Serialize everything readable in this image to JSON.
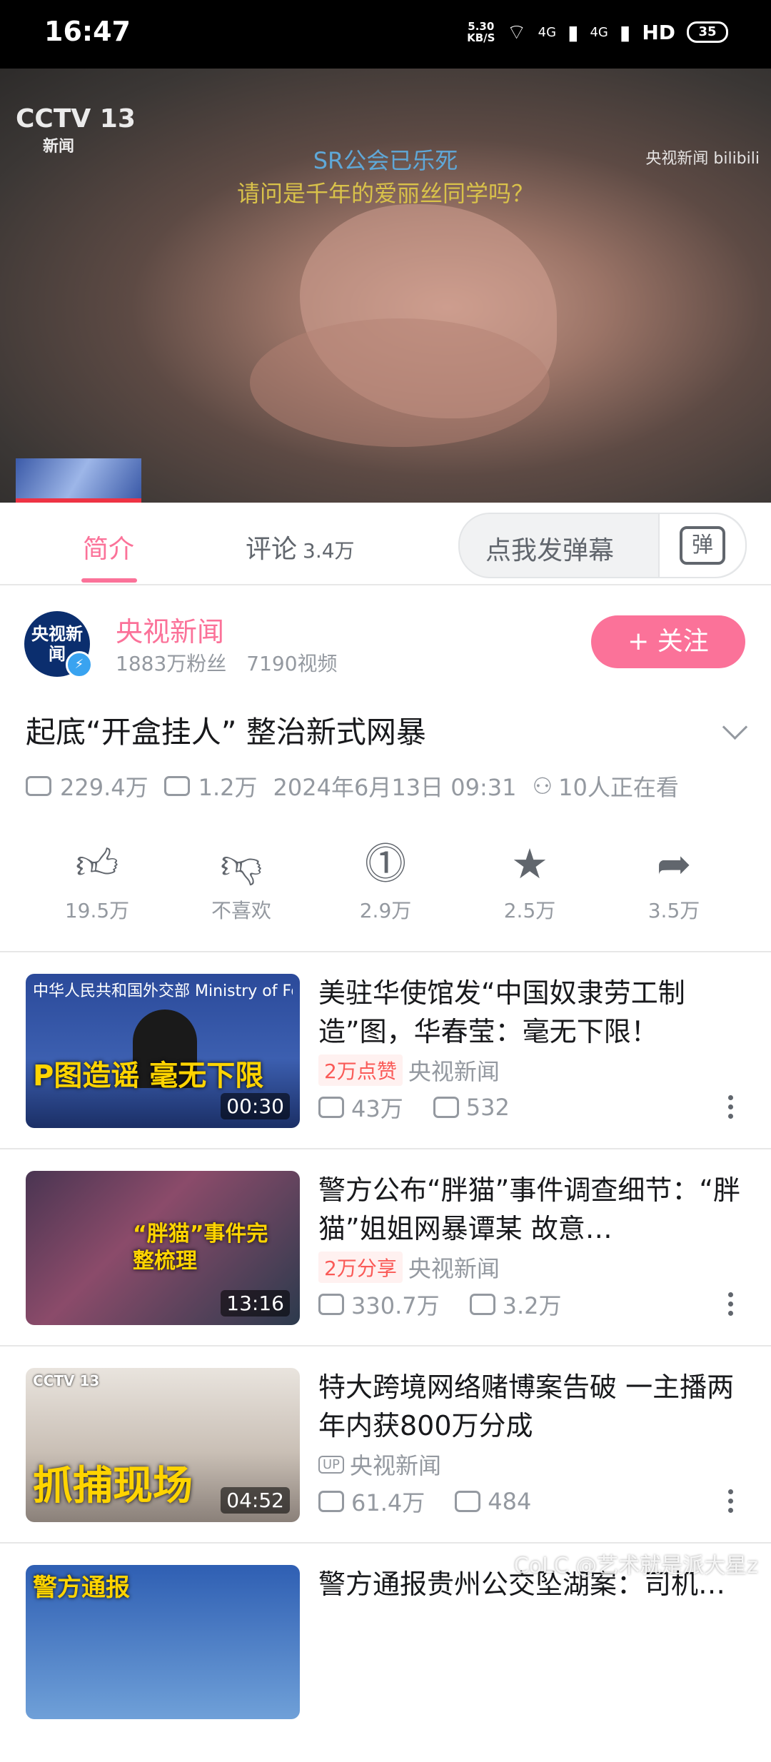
{
  "status_bar": {
    "time": "16:47",
    "net_speed_value": "5.30",
    "net_speed_unit": "KB/S",
    "signal1": "4G",
    "signal2": "4G",
    "hd": "HD",
    "battery": "35"
  },
  "player": {
    "channel_logo": "CCTV 13",
    "channel_sub": "新闻",
    "source_logo": "央视新闻 bilibili",
    "subtitle_line1": "SR公会已乐死",
    "subtitle_line2": "请问是千年的爱丽丝同学吗？"
  },
  "tabs": {
    "intro": "简介",
    "comments": "评论",
    "comments_count": "3.4万",
    "danmu_placeholder": "点我发弹幕",
    "danmu_icon": "弹"
  },
  "uploader": {
    "avatar_text": "央视新闻",
    "name": "央视新闻",
    "fans": "1883万粉丝",
    "videos": "7190视频",
    "follow": "关注",
    "follow_icon": "+"
  },
  "video": {
    "title": "起底“开盒挂人” 整治新式网暴",
    "views": "229.4万",
    "danmaku": "1.2万",
    "date": "2024年6月13日 09:31",
    "watching": "10人正在看"
  },
  "actions": [
    {
      "icon": "like-icon",
      "label": "19.5万"
    },
    {
      "icon": "dislike-icon",
      "label": "不喜欢"
    },
    {
      "icon": "coin-icon",
      "label": "2.9万"
    },
    {
      "icon": "favorite-icon",
      "label": "2.5万"
    },
    {
      "icon": "share-icon",
      "label": "3.5万"
    }
  ],
  "recommendations": [
    {
      "title": "美驻华使馆发“中国奴隶劳工制造”图，华春莹：毫无下限！",
      "tag": "2万点赞",
      "author": "央视新闻",
      "views": "43万",
      "danmaku": "532",
      "duration": "00:30",
      "cover_text": "P图造谣 毫无下限",
      "cover_header": "中华人民共和国外交部 Ministry of Foreign Affairs"
    },
    {
      "title": "警方公布“胖猫”事件调查细节：“胖猫”姐姐网暴谭某 故意…",
      "tag": "2万分享",
      "author": "央视新闻",
      "views": "330.7万",
      "danmaku": "3.2万",
      "duration": "13:16",
      "cover_text": "“胖猫”事件完整梳理"
    },
    {
      "title": "特大跨境网络赌博案告破 一主播两年内获800万分成",
      "tag": "UP",
      "author": "央视新闻",
      "views": "61.4万",
      "danmaku": "484",
      "duration": "04:52",
      "cover_text": "抓捕现场"
    },
    {
      "title": "警方通报贵州公交坠湖案：司机…",
      "cover_text": "警方通报"
    }
  ],
  "watermark": "CoLC @艺术就是派大星z"
}
